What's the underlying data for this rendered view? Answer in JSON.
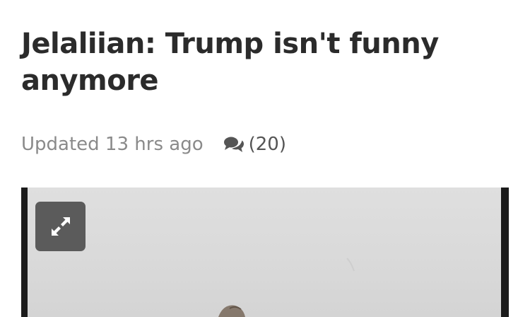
{
  "article": {
    "headline": "Jelaliian: Trump isn't funny anymore",
    "updated": "Updated 13 hrs ago",
    "comments_count": "(20)"
  },
  "icons": {
    "comments": "comments-icon",
    "expand": "expand-icon"
  },
  "colors": {
    "headline": "#2b2b2b",
    "meta": "#8a8a8a",
    "comments": "#555555",
    "expand_button_bg": "#5b5b5b",
    "photo_frame": "#1b1b1b"
  }
}
